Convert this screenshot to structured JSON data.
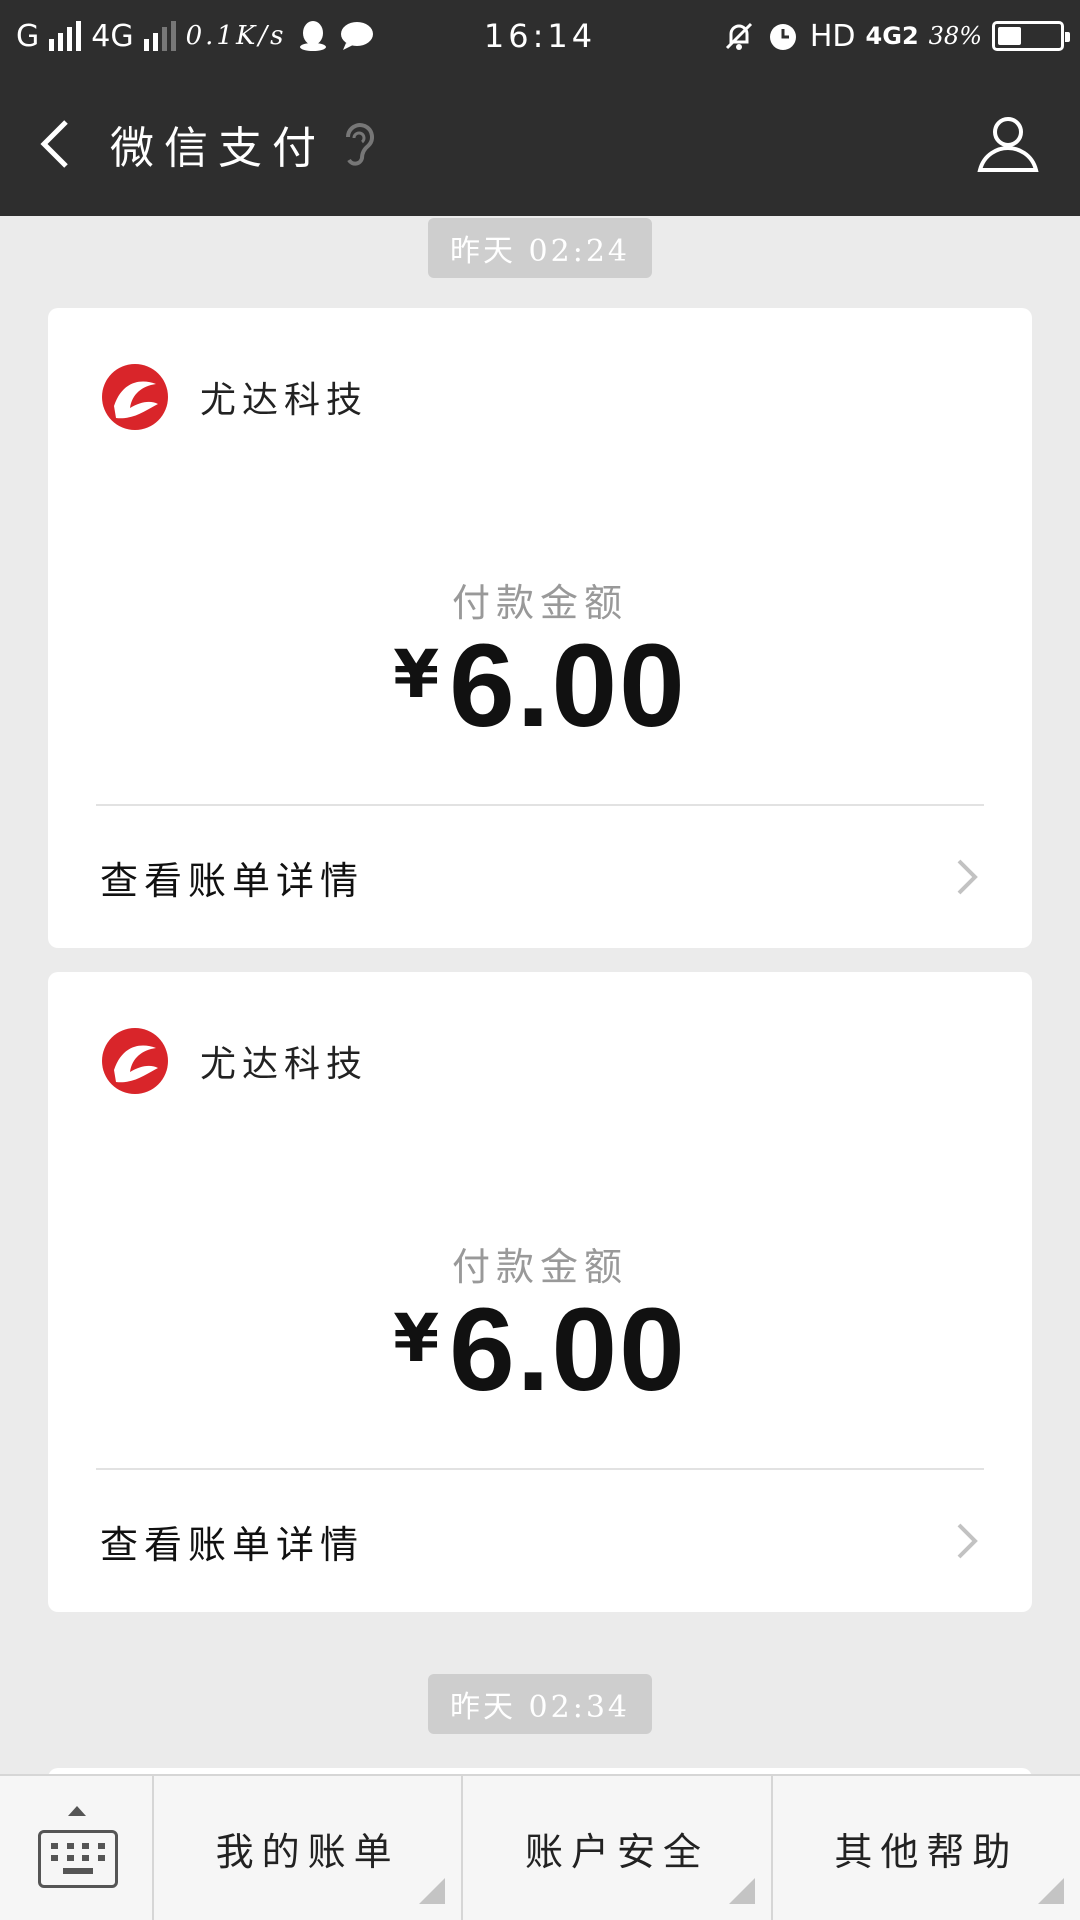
{
  "status_bar": {
    "carrier1": "G",
    "carrier2": "4G",
    "speed": "0.1K/s",
    "time": "16:14",
    "network": "HD",
    "network_type": "4G2",
    "battery": "38%",
    "battery_level": 0.38
  },
  "header": {
    "title": "微信支付"
  },
  "timestamps": [
    "昨天 02:24",
    "昨天 02:34"
  ],
  "cards": [
    {
      "merchant": "尤达科技",
      "amount_label": "付款金额",
      "currency": "¥",
      "amount": "6.00",
      "detail_label": "查看账单详情"
    },
    {
      "merchant": "尤达科技",
      "amount_label": "付款金额",
      "currency": "¥",
      "amount": "6.00",
      "detail_label": "查看账单详情"
    }
  ],
  "bottom_menu": {
    "items": [
      {
        "label": "我的账单"
      },
      {
        "label": "账户安全"
      },
      {
        "label": "其他帮助"
      }
    ]
  },
  "icons": {
    "back": "back-arrow-icon",
    "ear": "ear-icon",
    "profile": "person-icon",
    "chevron": "chevron-right-icon",
    "keyboard": "keyboard-icon"
  },
  "colors": {
    "header_bg": "#2e2e2e",
    "page_bg": "#ebebeb",
    "logo_red": "#d9252a"
  }
}
